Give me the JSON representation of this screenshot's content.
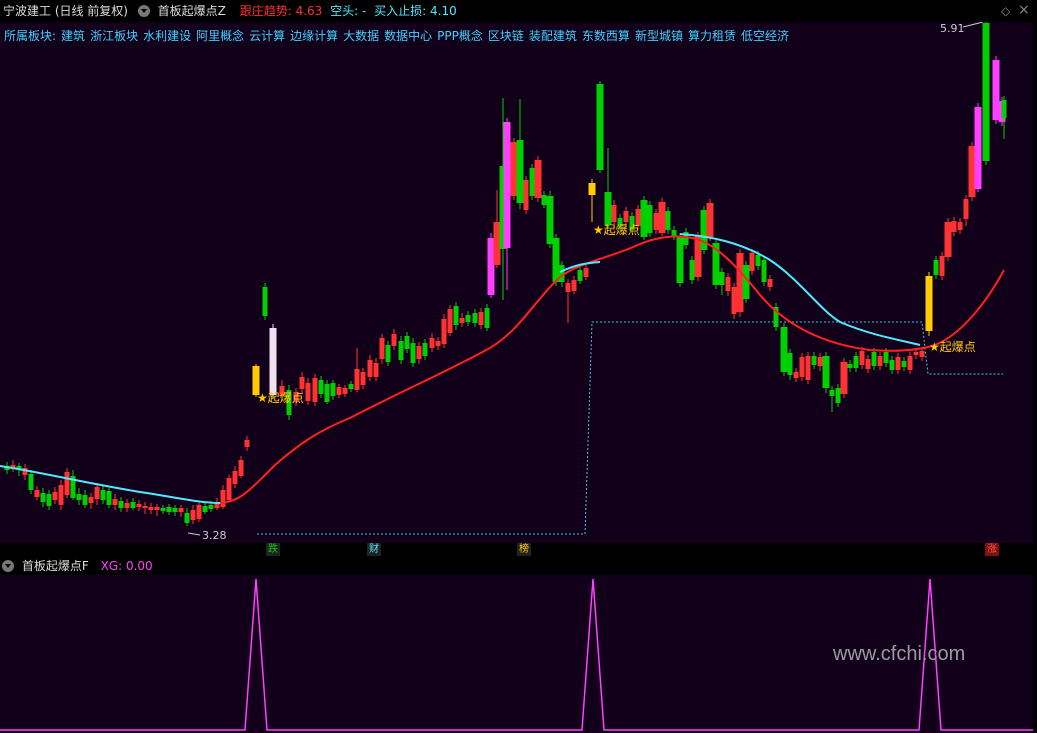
{
  "header": {
    "stock_title": "宁波建工 (日线 前复权)",
    "indicator_name": "首板起爆点Z",
    "trend_label": "跟庄趋势: 4.63",
    "short_label": "空头: -",
    "stop_label": "买入止损: 4.10",
    "close_icon": "×",
    "diamond_icon": "◇"
  },
  "sectors": {
    "prefix": "所属板块:",
    "items": [
      "建筑",
      "浙江板块",
      "水利建设",
      "阿里概念",
      "云计算",
      "边缘计算",
      "大数据",
      "数据中心",
      "PPP概念",
      "区块链",
      "装配建筑",
      "东数西算",
      "新型城镇",
      "算力租赁",
      "低空经济"
    ]
  },
  "colors": {
    "up": "#ff3333",
    "down": "#00d000",
    "pink": "#ff40ff",
    "white_bar": "#f0e0f0",
    "yellow": "#ffcc00",
    "ma_red": "#ff2020",
    "ma_cyan": "#50e8ff",
    "stop_line": "#40c8e0",
    "xg_line": "#ff40ff"
  },
  "annotations": {
    "high_label": "5.91",
    "low_label": "3.28",
    "signal_label": "起爆点",
    "signal_star": "★"
  },
  "markers": [
    {
      "label": "跌",
      "color": "#00d000"
    },
    {
      "label": "财",
      "color": "#50e8ff"
    },
    {
      "label": "榜",
      "color": "#ffcc00"
    },
    {
      "label": "涨",
      "color": "#ff5050"
    }
  ],
  "sub_panel": {
    "name": "首板起爆点F",
    "xg_label": "XG: 0.00"
  },
  "watermark": "www.cfchi.com",
  "price_axis": {
    "min": 3.0,
    "max": 6.0
  }
}
